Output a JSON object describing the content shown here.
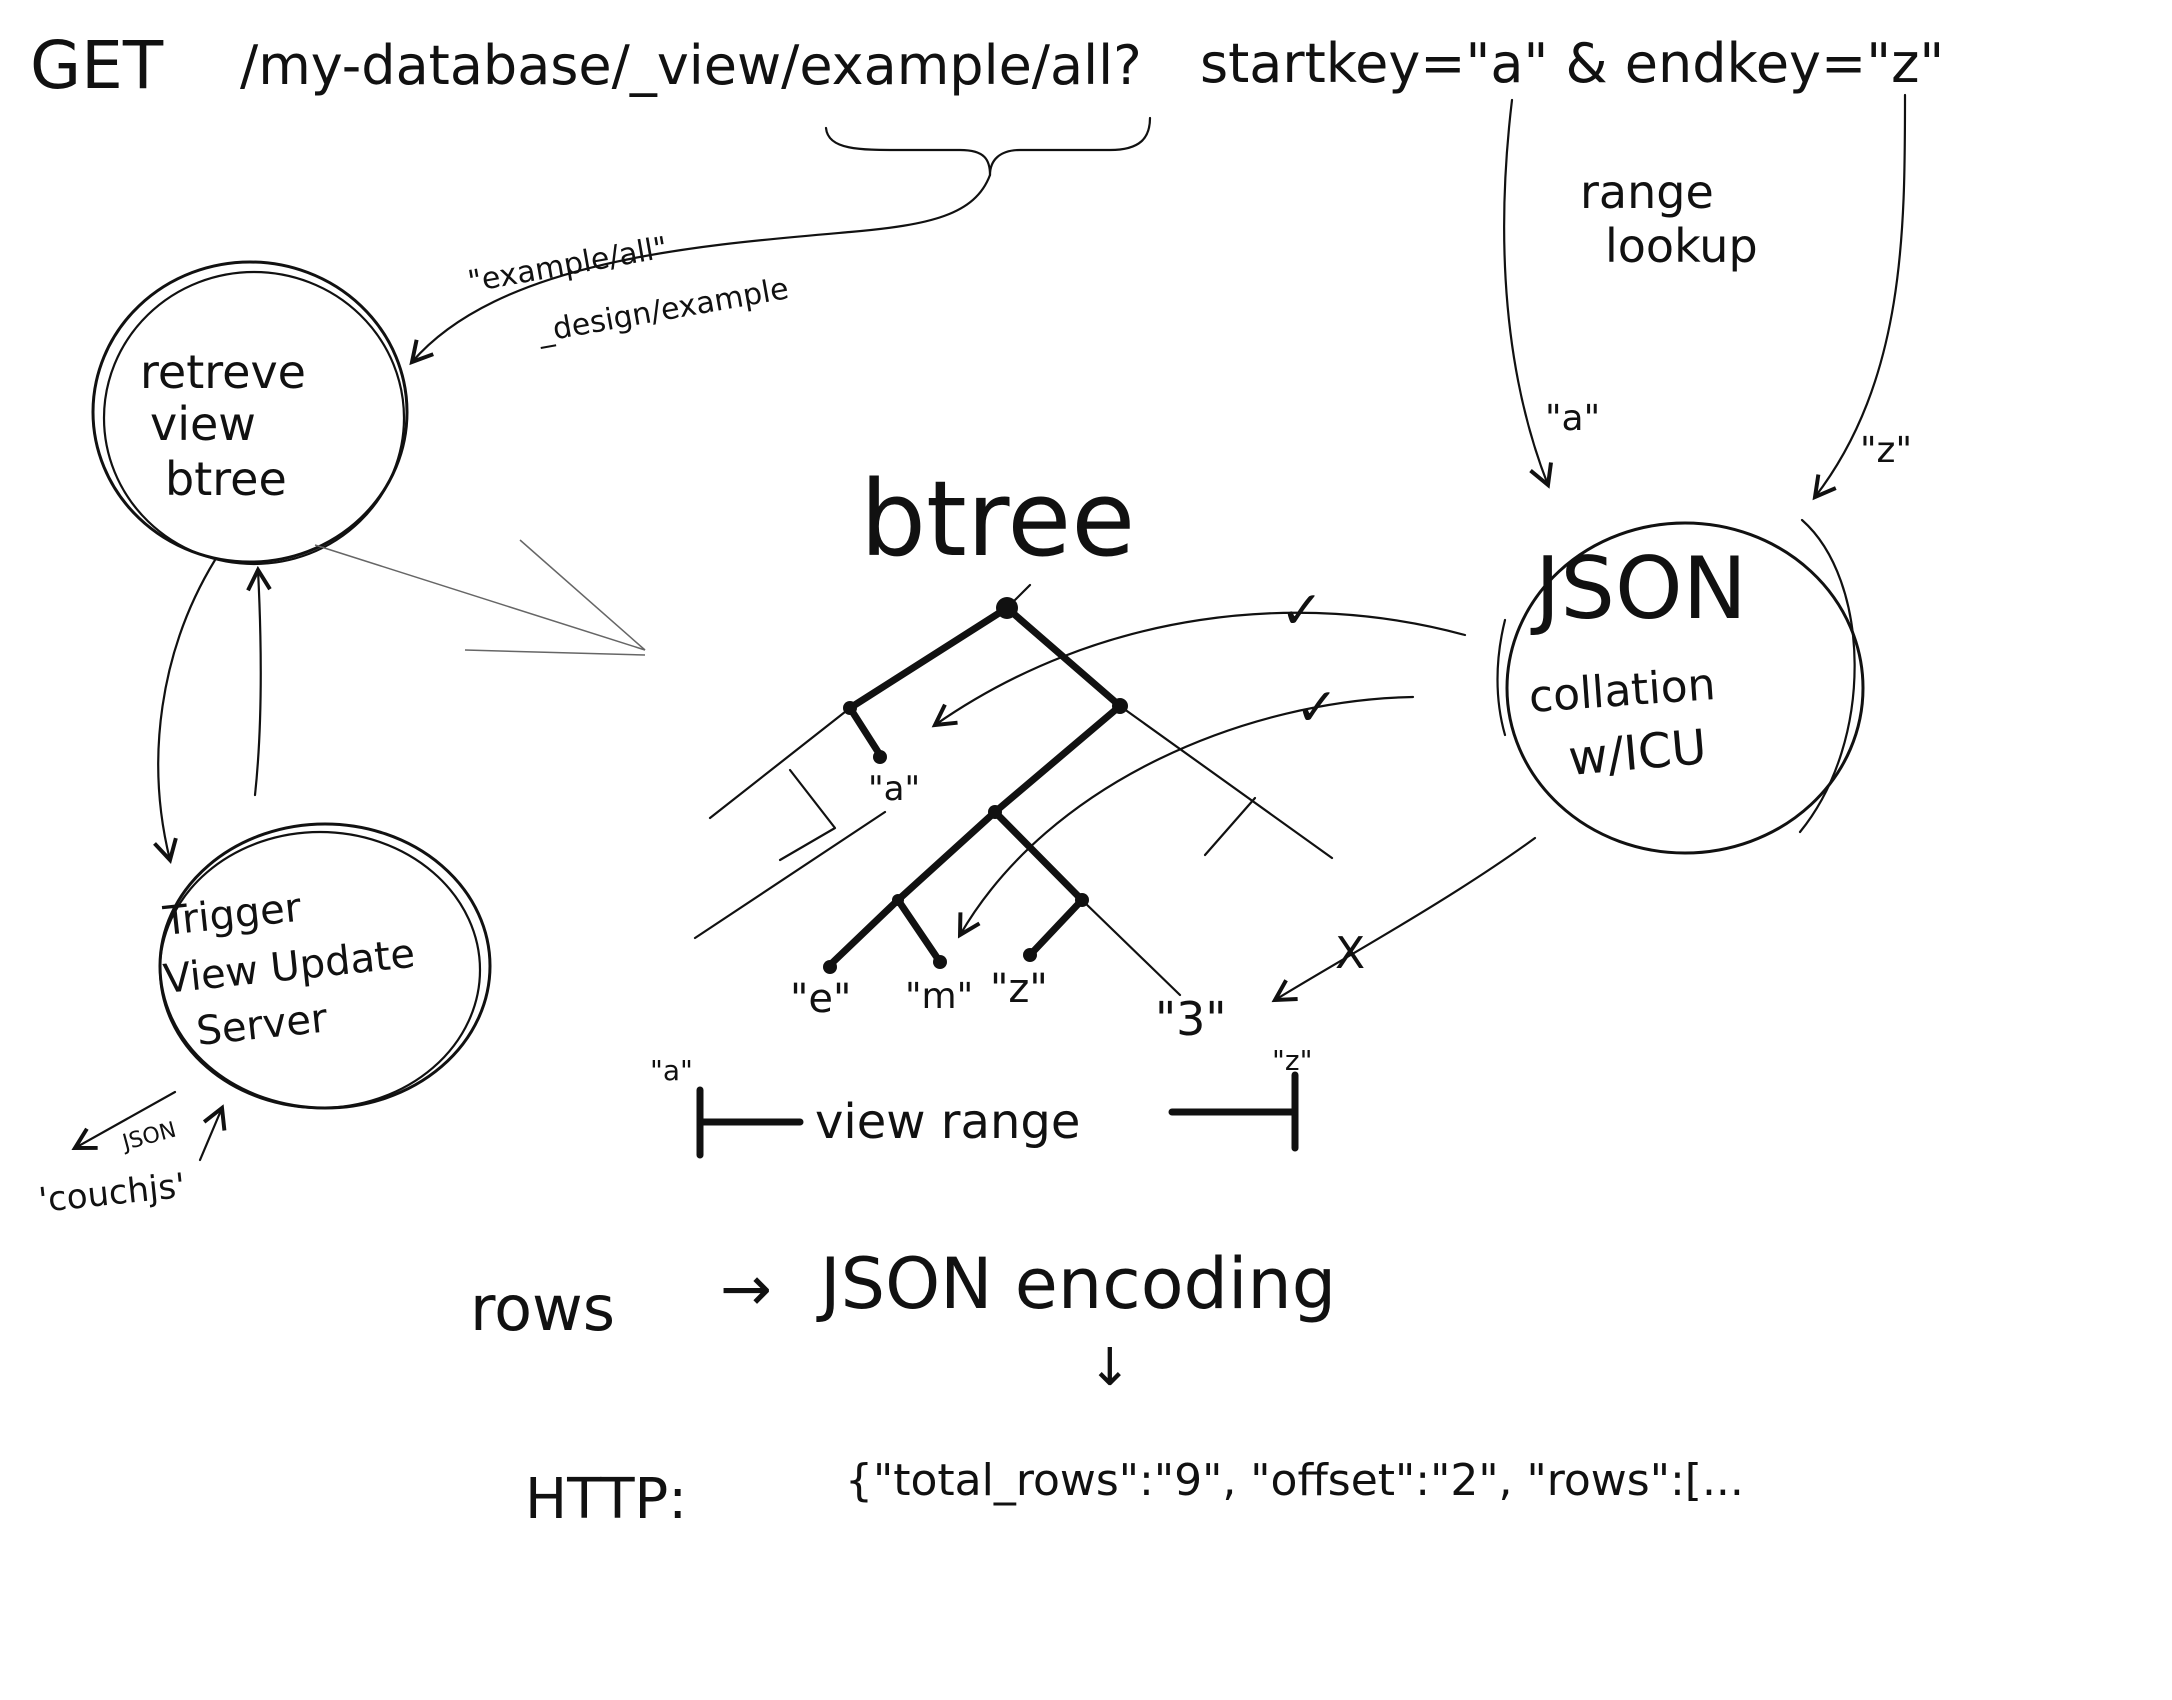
{
  "request": {
    "method": "GET",
    "path": "/my-database/_view/example/all?",
    "query": "startkey=\"a\" & endkey=\"z\""
  },
  "range_lookup": {
    "line1": "range",
    "line2": "lookup"
  },
  "design_doc": {
    "line1": "\"example/all\"",
    "line2": "_design/example"
  },
  "retrieve_node": {
    "line1": "retreve",
    "line2": "view",
    "line3": "btree"
  },
  "trigger_node": {
    "line1": "Trigger",
    "line2": "View Update",
    "line3": "Server"
  },
  "couchjs": {
    "json_label": "JSON",
    "label": "'couchjs'"
  },
  "btree": {
    "title": "btree",
    "leaf_labels": [
      "\"a\"",
      "\"e\"",
      "\"m\"",
      "\"z\"",
      "\"3\""
    ]
  },
  "json_collation": {
    "line1": "JSON",
    "line2": "collation",
    "line3": "w/ICU",
    "key_a": "\"a\"",
    "key_z": "\"z\"",
    "check1": "✓",
    "check2": "✓",
    "cross": "X"
  },
  "view_range": {
    "label": "view range",
    "start": "\"a\"",
    "end": "\"z\""
  },
  "encoding": {
    "rows": "rows",
    "arrow": "→",
    "target": "JSON encoding",
    "down": "↓"
  },
  "http": {
    "label": "HTTP:",
    "body": "{\"total_rows\":\"9\", \"offset\":\"2\", \"rows\":[..."
  }
}
